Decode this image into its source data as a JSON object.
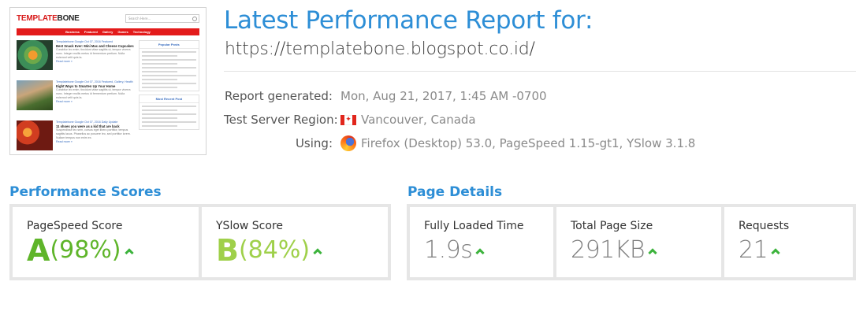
{
  "thumbnail": {
    "logo_part1": "TEMPLATE",
    "logo_part2": "BONE",
    "search_placeholder": "Search Here...",
    "nav": [
      "Business",
      "Featured",
      "Gallery",
      "Games",
      "Technology"
    ],
    "posts": [
      {
        "meta": "Templatebone Google Oct 07, 2016 Featured",
        "title": "Best Snack Ever: Mini Mac and Cheese Cupcakes",
        "excerpt": "Curabitur leo enim, tincidunt vitae sagittis ut, tempor viverra nunc. Integer mollis metus id fermentum pretium. Nulla euismod velit quis la.",
        "more": "Read more »"
      },
      {
        "meta": "Templatebone Google Oct 07, 2016 Featured, Gallery, Health",
        "title": "Eight Ways to Smarten Up Your Home",
        "excerpt": "Curabitur leo enim, tincidunt vitae sagittis ut, tempor viverra nunc. Integer mollis metus id fermentum pretium. Nulla euismod velit quis la.",
        "more": "Read more »"
      },
      {
        "meta": "Templatebone Google Oct 07, 2016 Daily Update",
        "title": "11 shoes you were as a kid that are back",
        "excerpt": "Suspendisse leo sem, cursus eget libero porttitor, tempus sagittis lacus. Phasellus ac posuere leo, sed porttitor lorem. Nullam tempus non enim ex.",
        "more": "Read more »"
      }
    ],
    "widget1_title": "Popular Posts",
    "widget2_title": "Most Recent Post"
  },
  "header": {
    "title": "Latest Performance Report for:",
    "url": "https://templatebone.blogspot.co.id/"
  },
  "meta": {
    "generated_label": "Report generated:",
    "generated_value": "Mon, Aug 21, 2017, 1:45 AM -0700",
    "region_label": "Test Server Region:",
    "region_value": "Vancouver, Canada",
    "using_label": "Using:",
    "using_value": "Firefox (Desktop) 53.0, PageSpeed 1.15-gt1, YSlow 3.1.8"
  },
  "performance": {
    "section_title": "Performance Scores",
    "pagespeed": {
      "label": "PageSpeed Score",
      "grade": "A",
      "percent": "(98%)"
    },
    "yslow": {
      "label": "YSlow Score",
      "grade": "B",
      "percent": "(84%)"
    }
  },
  "details": {
    "section_title": "Page Details",
    "load_time": {
      "label": "Fully Loaded Time",
      "value": "1.9s"
    },
    "page_size": {
      "label": "Total Page Size",
      "value": "291KB"
    },
    "requests": {
      "label": "Requests",
      "value": "21"
    }
  },
  "colors": {
    "accent": "#2d8ed6",
    "grade_a": "#5fb52a",
    "grade_b": "#9fd04a",
    "trend_up": "#3cb33c"
  }
}
